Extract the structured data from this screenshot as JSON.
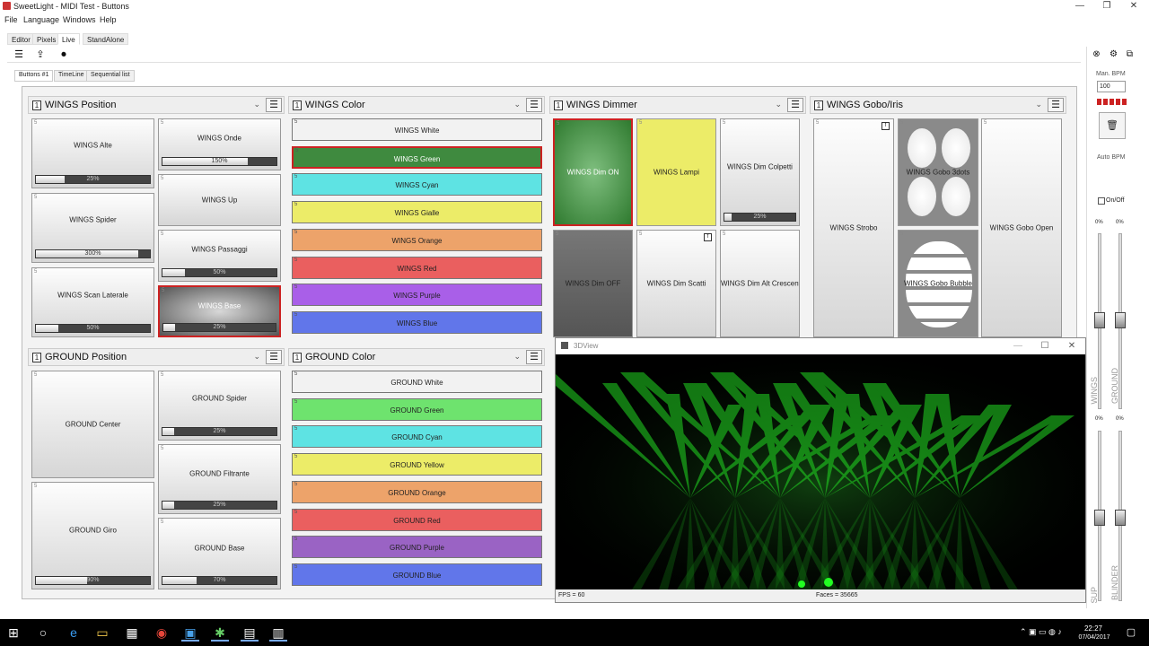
{
  "window": {
    "title": "SweetLight - MIDI Test - Buttons"
  },
  "menu": [
    "File",
    "Language",
    "Windows",
    "Help"
  ],
  "main_tabs": [
    "Editor",
    "Pixels",
    "Live",
    "StandAlone"
  ],
  "sub_tabs": [
    "Buttons #1",
    "TimeLine",
    "Sequential list"
  ],
  "groups": {
    "wings_position": {
      "num": "1",
      "title": "WINGS Position",
      "buttons": [
        {
          "label": "WINGS Alte",
          "corner": "5",
          "pct": "25%",
          "fill": 0.25
        },
        {
          "label": "WINGS Onde",
          "corner": "5",
          "pct": "150%",
          "fill": 0.75
        },
        {
          "label": "WINGS Spider",
          "corner": "5",
          "pct": "300%",
          "fill": 0.9
        },
        {
          "label": "WINGS Up",
          "corner": "5"
        },
        {
          "label": "WINGS Passaggi",
          "corner": "5",
          "pct": "50%",
          "fill": 0.2
        },
        {
          "label": "WINGS Scan Laterale",
          "corner": "5",
          "pct": "50%",
          "fill": 0.2
        },
        {
          "label": "WINGS Base",
          "corner": "5",
          "pct": "25%",
          "fill": 0.1
        }
      ]
    },
    "wings_color": {
      "num": "1",
      "title": "WINGS Color",
      "buttons": [
        {
          "label": "WINGS White",
          "corner": "5",
          "color": "#f2f2f2"
        },
        {
          "label": "WINGS Green",
          "corner": "5",
          "color": "#3f8a3f"
        },
        {
          "label": "WINGS Cyan",
          "corner": "5",
          "color": "#5ee3e3"
        },
        {
          "label": "WINGS Gialle",
          "corner": "5",
          "color": "#ecec68"
        },
        {
          "label": "WINGS Orange",
          "corner": "5",
          "color": "#eda36a"
        },
        {
          "label": "WINGS Red",
          "corner": "5",
          "color": "#ea5f5f"
        },
        {
          "label": "WINGS Purple",
          "corner": "5",
          "color": "#a95fe8"
        },
        {
          "label": "WINGS Blue",
          "corner": "5",
          "color": "#6176ea"
        }
      ]
    },
    "wings_dimmer": {
      "num": "1",
      "title": "WINGS Dimmer",
      "buttons": [
        {
          "label": "WINGS Dim ON",
          "corner": "5"
        },
        {
          "label": "WINGS Lampi",
          "corner": "5"
        },
        {
          "label": "WINGS Dim Colpetti",
          "corner": "5",
          "pct": "25%",
          "fill": 0.1
        },
        {
          "label": "WINGS Dim OFF",
          "corner": "5"
        },
        {
          "label": "WINGS Dim Scatti",
          "corner": "5",
          "flag": "f"
        },
        {
          "label": "WINGS Dim Alt Crescenti",
          "corner": "5"
        }
      ]
    },
    "wings_gobo": {
      "num": "1",
      "title": "WINGS Gobo/Iris",
      "buttons": [
        {
          "label": "WINGS Strobo",
          "corner": "5",
          "flag": "f"
        },
        {
          "label": "WINGS Gobo 3dots",
          "corner": "5"
        },
        {
          "label": "WINGS Gobo Open",
          "corner": "5"
        },
        {
          "label": "WINGS Gobo Bubble",
          "corner": "5"
        }
      ]
    },
    "ground_position": {
      "num": "1",
      "title": "GROUND Position",
      "buttons": [
        {
          "label": "GROUND Center",
          "corner": "5"
        },
        {
          "label": "GROUND Spider",
          "corner": "5",
          "pct": "25%",
          "fill": 0.1
        },
        {
          "label": "GROUND Filtrante",
          "corner": "5",
          "pct": "25%",
          "fill": 0.1
        },
        {
          "label": "GROUND Giro",
          "corner": "5",
          "pct": "90%",
          "fill": 0.45
        },
        {
          "label": "GROUND Base",
          "corner": "5",
          "pct": "70%",
          "fill": 0.3
        }
      ]
    },
    "ground_color": {
      "num": "1",
      "title": "GROUND Color",
      "buttons": [
        {
          "label": "GROUND White",
          "corner": "5",
          "color": "#f2f2f2"
        },
        {
          "label": "GROUND Green",
          "corner": "5",
          "color": "#6ee36e"
        },
        {
          "label": "GROUND Cyan",
          "corner": "5",
          "color": "#5ee3e3"
        },
        {
          "label": "GROUND Yellow",
          "corner": "5",
          "color": "#ecec68"
        },
        {
          "label": "GROUND Orange",
          "corner": "5",
          "color": "#eda36a"
        },
        {
          "label": "GROUND Red",
          "corner": "5",
          "color": "#ea5f5f"
        },
        {
          "label": "GROUND Purple",
          "corner": "5",
          "color": "#9a63c4"
        },
        {
          "label": "GROUND Blue",
          "corner": "5",
          "color": "#6176ea"
        }
      ]
    }
  },
  "view3d": {
    "title": "3DView",
    "fps": "FPS = 60",
    "faces": "Faces = 35665"
  },
  "right_panel": {
    "bpm_label": "Man. BPM",
    "bpm_value": "100",
    "auto_bpm": "Auto BPM",
    "onoff": "On/Off",
    "faders": [
      {
        "name": "WINGS",
        "pct": "0%"
      },
      {
        "name": "GROUND",
        "pct": "0%"
      },
      {
        "name": "SUP",
        "pct": "0%"
      },
      {
        "name": "BLINDER",
        "pct": "0%"
      }
    ]
  },
  "taskbar": {
    "time": "22:27",
    "date": "07/04/2017"
  }
}
